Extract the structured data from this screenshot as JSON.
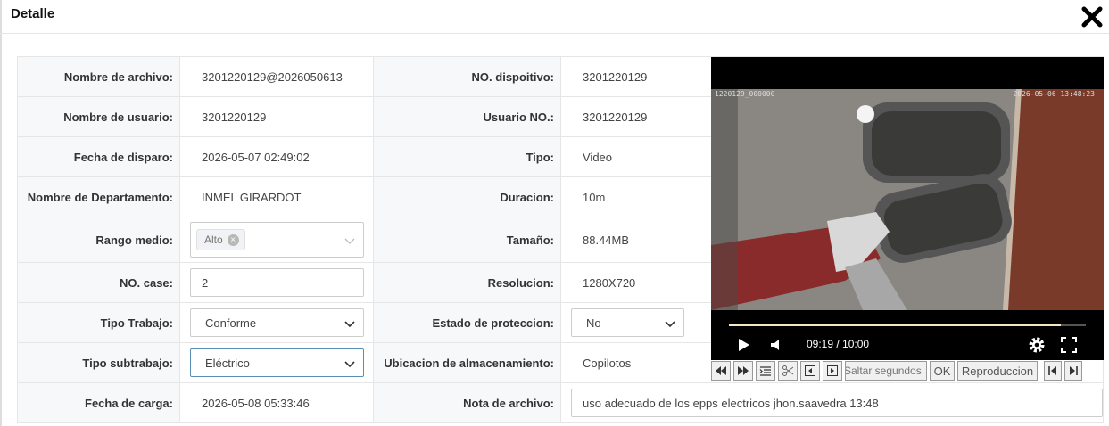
{
  "dialog": {
    "title": "Detalle"
  },
  "fields": {
    "nombre_archivo": {
      "label": "Nombre de archivo:",
      "value": "3201220129@2026050613"
    },
    "no_dispositivo": {
      "label": "NO. dispoitivo:",
      "value": "3201220129"
    },
    "nombre_usuario": {
      "label": "Nombre de usuario:",
      "value": "3201220129"
    },
    "usuario_no": {
      "label": "Usuario NO.:",
      "value": "3201220129"
    },
    "fecha_disparo": {
      "label": "Fecha de disparo:",
      "value": "2026-05-07 02:49:02"
    },
    "tipo": {
      "label": "Tipo:",
      "value": "Video"
    },
    "departamento": {
      "label": "Nombre de Departamento:",
      "value": "INMEL GIRARDOT"
    },
    "duracion": {
      "label": "Duracion:",
      "value": "10m"
    },
    "rango_medio": {
      "label": "Rango medio:",
      "tag": "Alto"
    },
    "tamano": {
      "label": "Tamaño:",
      "value": "88.44MB"
    },
    "no_case": {
      "label": "NO. case:",
      "value": "2"
    },
    "resolucion": {
      "label": "Resolucion:",
      "value": "1280X720"
    },
    "tipo_trabajo": {
      "label": "Tipo Trabajo:",
      "value": "Conforme"
    },
    "estado_proteccion": {
      "label": "Estado de proteccion:",
      "value": "No"
    },
    "tipo_subtrabajo": {
      "label": "Tipo subtrabajo:",
      "value": "Eléctrico"
    },
    "ubicacion": {
      "label": "Ubicacion de almacenamiento:",
      "value": "Copilotos"
    },
    "fecha_carga": {
      "label": "Fecha de carga:",
      "value": "2026-05-08 05:33:46"
    },
    "nota": {
      "label": "Nota de archivo:",
      "value": "uso adecuado de los epps electricos jhon.saavedra 13:48"
    }
  },
  "player": {
    "osd_left": "1220129_000000",
    "osd_right": "2026-05-06 13:48:23",
    "time": "09:19 / 10:00",
    "progress": 0.93
  },
  "toolbar": {
    "seek_placeholder": "Saltar segundos",
    "ok_label": "OK",
    "playback_label": "Reproduccion"
  },
  "colors": {
    "focus_border": "#5a8fb5",
    "label_bg": "#f7f8fa"
  }
}
